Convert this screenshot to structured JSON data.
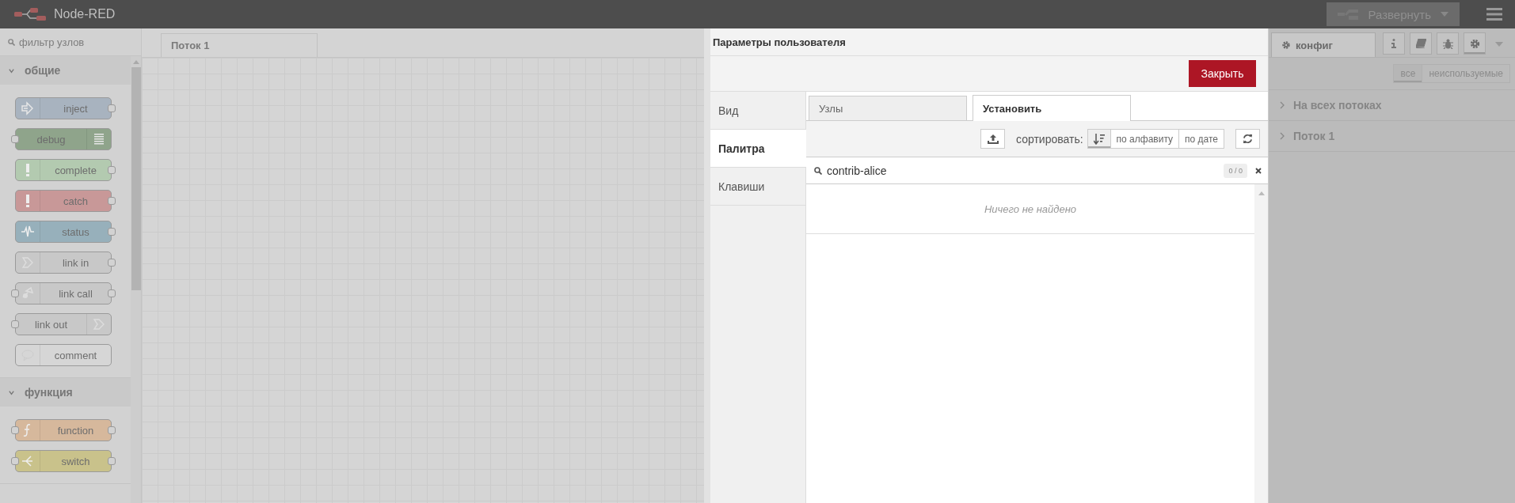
{
  "header": {
    "title": "Node-RED",
    "deploy_button": "Развернуть"
  },
  "palette": {
    "filter": {
      "placeholder": "фильтр узлов"
    },
    "categories": [
      {
        "name": "общие",
        "expanded": true,
        "nodes": [
          {
            "label": "inject",
            "kind": "inject",
            "color": "#a8b3bf",
            "icon_right": false,
            "input": false,
            "output": true
          },
          {
            "label": "debug",
            "kind": "debug",
            "color": "#8fa48b",
            "icon_right": true,
            "input": true,
            "output": false
          },
          {
            "label": "complete",
            "kind": "alert",
            "color": "#b3cab0",
            "icon_right": false,
            "input": false,
            "output": true
          },
          {
            "label": "catch",
            "kind": "alert",
            "color": "#c89898",
            "icon_right": false,
            "input": false,
            "output": true
          },
          {
            "label": "status",
            "kind": "pulse",
            "color": "#97b0bb",
            "icon_right": false,
            "input": false,
            "output": true
          },
          {
            "label": "link in",
            "kind": "link",
            "color": "#c8c8c8",
            "icon_right": false,
            "input": false,
            "output": true
          },
          {
            "label": "link call",
            "kind": "call",
            "color": "#c8c8c8",
            "icon_right": false,
            "input": true,
            "output": true
          },
          {
            "label": "link out",
            "kind": "link",
            "color": "#c8c8c8",
            "icon_right": true,
            "input": true,
            "output": false
          },
          {
            "label": "comment",
            "kind": "comment",
            "color": "#d6d6d6",
            "icon_right": false,
            "input": false,
            "output": false
          }
        ]
      },
      {
        "name": "функция",
        "expanded": true,
        "nodes": [
          {
            "label": "function",
            "kind": "function",
            "color": "#d6b89c",
            "icon_right": false,
            "input": true,
            "output": true
          },
          {
            "label": "switch",
            "kind": "switch",
            "color": "#c9c28b",
            "icon_right": false,
            "input": true,
            "output": true
          }
        ]
      }
    ]
  },
  "workspace": {
    "tabs": [
      {
        "label": "Поток 1",
        "selected": true
      }
    ]
  },
  "dialog": {
    "title": "Параметры пользователя",
    "close_button": "Закрыть",
    "sections": [
      {
        "label": "Вид",
        "selected": false
      },
      {
        "label": "Палитра",
        "selected": true
      },
      {
        "label": "Клавиши",
        "selected": false
      }
    ],
    "tabs": [
      {
        "label": "Узлы",
        "selected": false
      },
      {
        "label": "Установить",
        "selected": true
      }
    ],
    "sort_label": "сортировать:",
    "sort_options": [
      {
        "kind": "icon",
        "selected": true
      },
      {
        "kind": "text",
        "label": "по алфавиту",
        "selected": false
      },
      {
        "kind": "text",
        "label": "по дате",
        "selected": false
      }
    ],
    "search": {
      "value": "contrib-alice",
      "count": "0 / 0"
    },
    "empty_message": "Ничего не найдено"
  },
  "sidebar": {
    "tab": {
      "label": "конфиг",
      "selected": true
    },
    "icon_tabs": [
      {
        "kind": "info",
        "selected": false
      },
      {
        "kind": "book",
        "selected": false
      },
      {
        "kind": "bug",
        "selected": false
      },
      {
        "kind": "gear",
        "selected": true
      }
    ],
    "filters": [
      {
        "label": "все",
        "selected": true
      },
      {
        "label": "неиспользуемые",
        "selected": false
      }
    ],
    "groups": [
      {
        "label": "На всех потоках",
        "expanded": false
      },
      {
        "label": "Поток 1",
        "expanded": false
      }
    ]
  }
}
